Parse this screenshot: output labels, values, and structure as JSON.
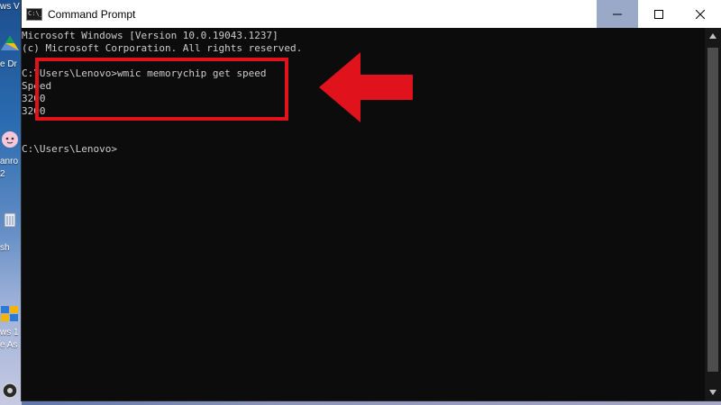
{
  "window": {
    "title": "Command Prompt",
    "icon": "command-prompt-icon"
  },
  "controls": {
    "minimize": "minimize-icon",
    "maximize": "maximize-icon",
    "close": "close-icon"
  },
  "console": {
    "lines": [
      "Microsoft Windows [Version 10.0.19043.1237]",
      "(c) Microsoft Corporation. All rights reserved.",
      "",
      "C:\\Users\\Lenovo>wmic memorychip get speed",
      "Speed",
      "3200",
      "3200",
      "",
      "",
      "C:\\Users\\Lenovo>"
    ]
  },
  "desktop": {
    "labels": [
      "ws V",
      "e Dr",
      "anro",
      "2",
      "sh",
      "ws 1",
      "e As"
    ]
  },
  "annotation": {
    "box_color": "#e0121b",
    "arrow_color": "#e0121b"
  },
  "colors": {
    "titlebar": "#ffffff",
    "console_background": "#0c0c0c",
    "console_text": "#cccccc",
    "minimize_hover": "#9aa9c7"
  }
}
